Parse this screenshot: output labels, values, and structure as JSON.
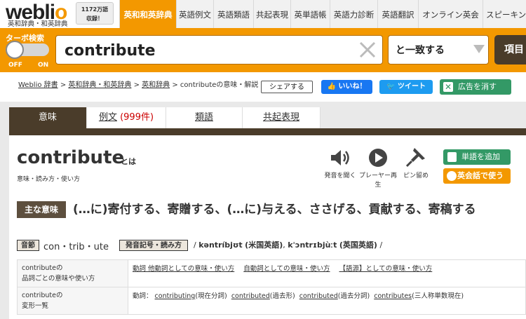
{
  "header": {
    "logo": "weblio",
    "logo_sub": "英和辞典・和英辞典",
    "badge_line1": "1172万語",
    "badge_line2": "収録！",
    "nav_tabs": [
      "英和和英辞典",
      "英語例文",
      "英語類語",
      "共起表現",
      "英単語帳",
      "英語力診断",
      "英語翻訳",
      "オンライン英会話",
      "スピーキング"
    ]
  },
  "search": {
    "turbo_label": "ターボ検索",
    "off_label": "OFF",
    "on_label": "ON",
    "query": "contribute",
    "match_mode": "と一致する",
    "item_button": "項目"
  },
  "breadcrumb": {
    "items": [
      "Weblio 辞書",
      "英和辞典・和英辞典",
      "英和辞典"
    ],
    "current": "contributeの意味・解説"
  },
  "social": {
    "share": "シェアする",
    "like": "いいね！",
    "tweet": "ツイート",
    "remove_ads": "広告を消す"
  },
  "tabs": {
    "meaning": "意味",
    "examples": "例文",
    "examples_count": "(999件)",
    "synonyms": "類語",
    "collocations": "共起表現"
  },
  "entry": {
    "headword": "contribute",
    "headword_suffix": "とは",
    "sub": "意味・読み方・使い方",
    "tools": {
      "listen": "発音を聞く",
      "player": "プレーヤー再生",
      "pin": "ピン留め"
    },
    "add_word": "単語を追加",
    "eikaiwa": "英会話で使う",
    "main_meaning_label": "主な意味",
    "main_meaning": "(…に)寄付する、寄贈する、(…に)与える、ささげる、貢献する、寄稿する",
    "syllable_label": "音節",
    "syllables": "con・trib・ute",
    "pron_label": "発音記号・読み方",
    "pron_us": "kəntríbjʊt",
    "pron_us_note": "(米国英語)",
    "pron_uk": "kˈɔntrɪbjùːt",
    "pron_uk_note": "(英国英語)"
  },
  "table": {
    "row1_head_1": "contributeの",
    "row1_head_2": "品詞ごとの意味や使い方",
    "row1_links": [
      "動詞 他動詞としての意味・使い方",
      "自動詞としての意味・使い方",
      "【語源】としての意味・使い方"
    ],
    "row2_head_1": "contributeの",
    "row2_head_2": "変形一覧",
    "row2_prefix": "動詞：",
    "row2_forms": [
      {
        "word": "contributing",
        "note": "(現在分詞)"
      },
      {
        "word": "contributed",
        "note": "(過去形)"
      },
      {
        "word": "contributed",
        "note": "(過去分詞)"
      },
      {
        "word": "contributes",
        "note": "(三人称単数現在)"
      }
    ]
  },
  "colors": {
    "brand_orange": "#f39800",
    "brand_brown": "#4a3c2a",
    "green": "#339966"
  }
}
